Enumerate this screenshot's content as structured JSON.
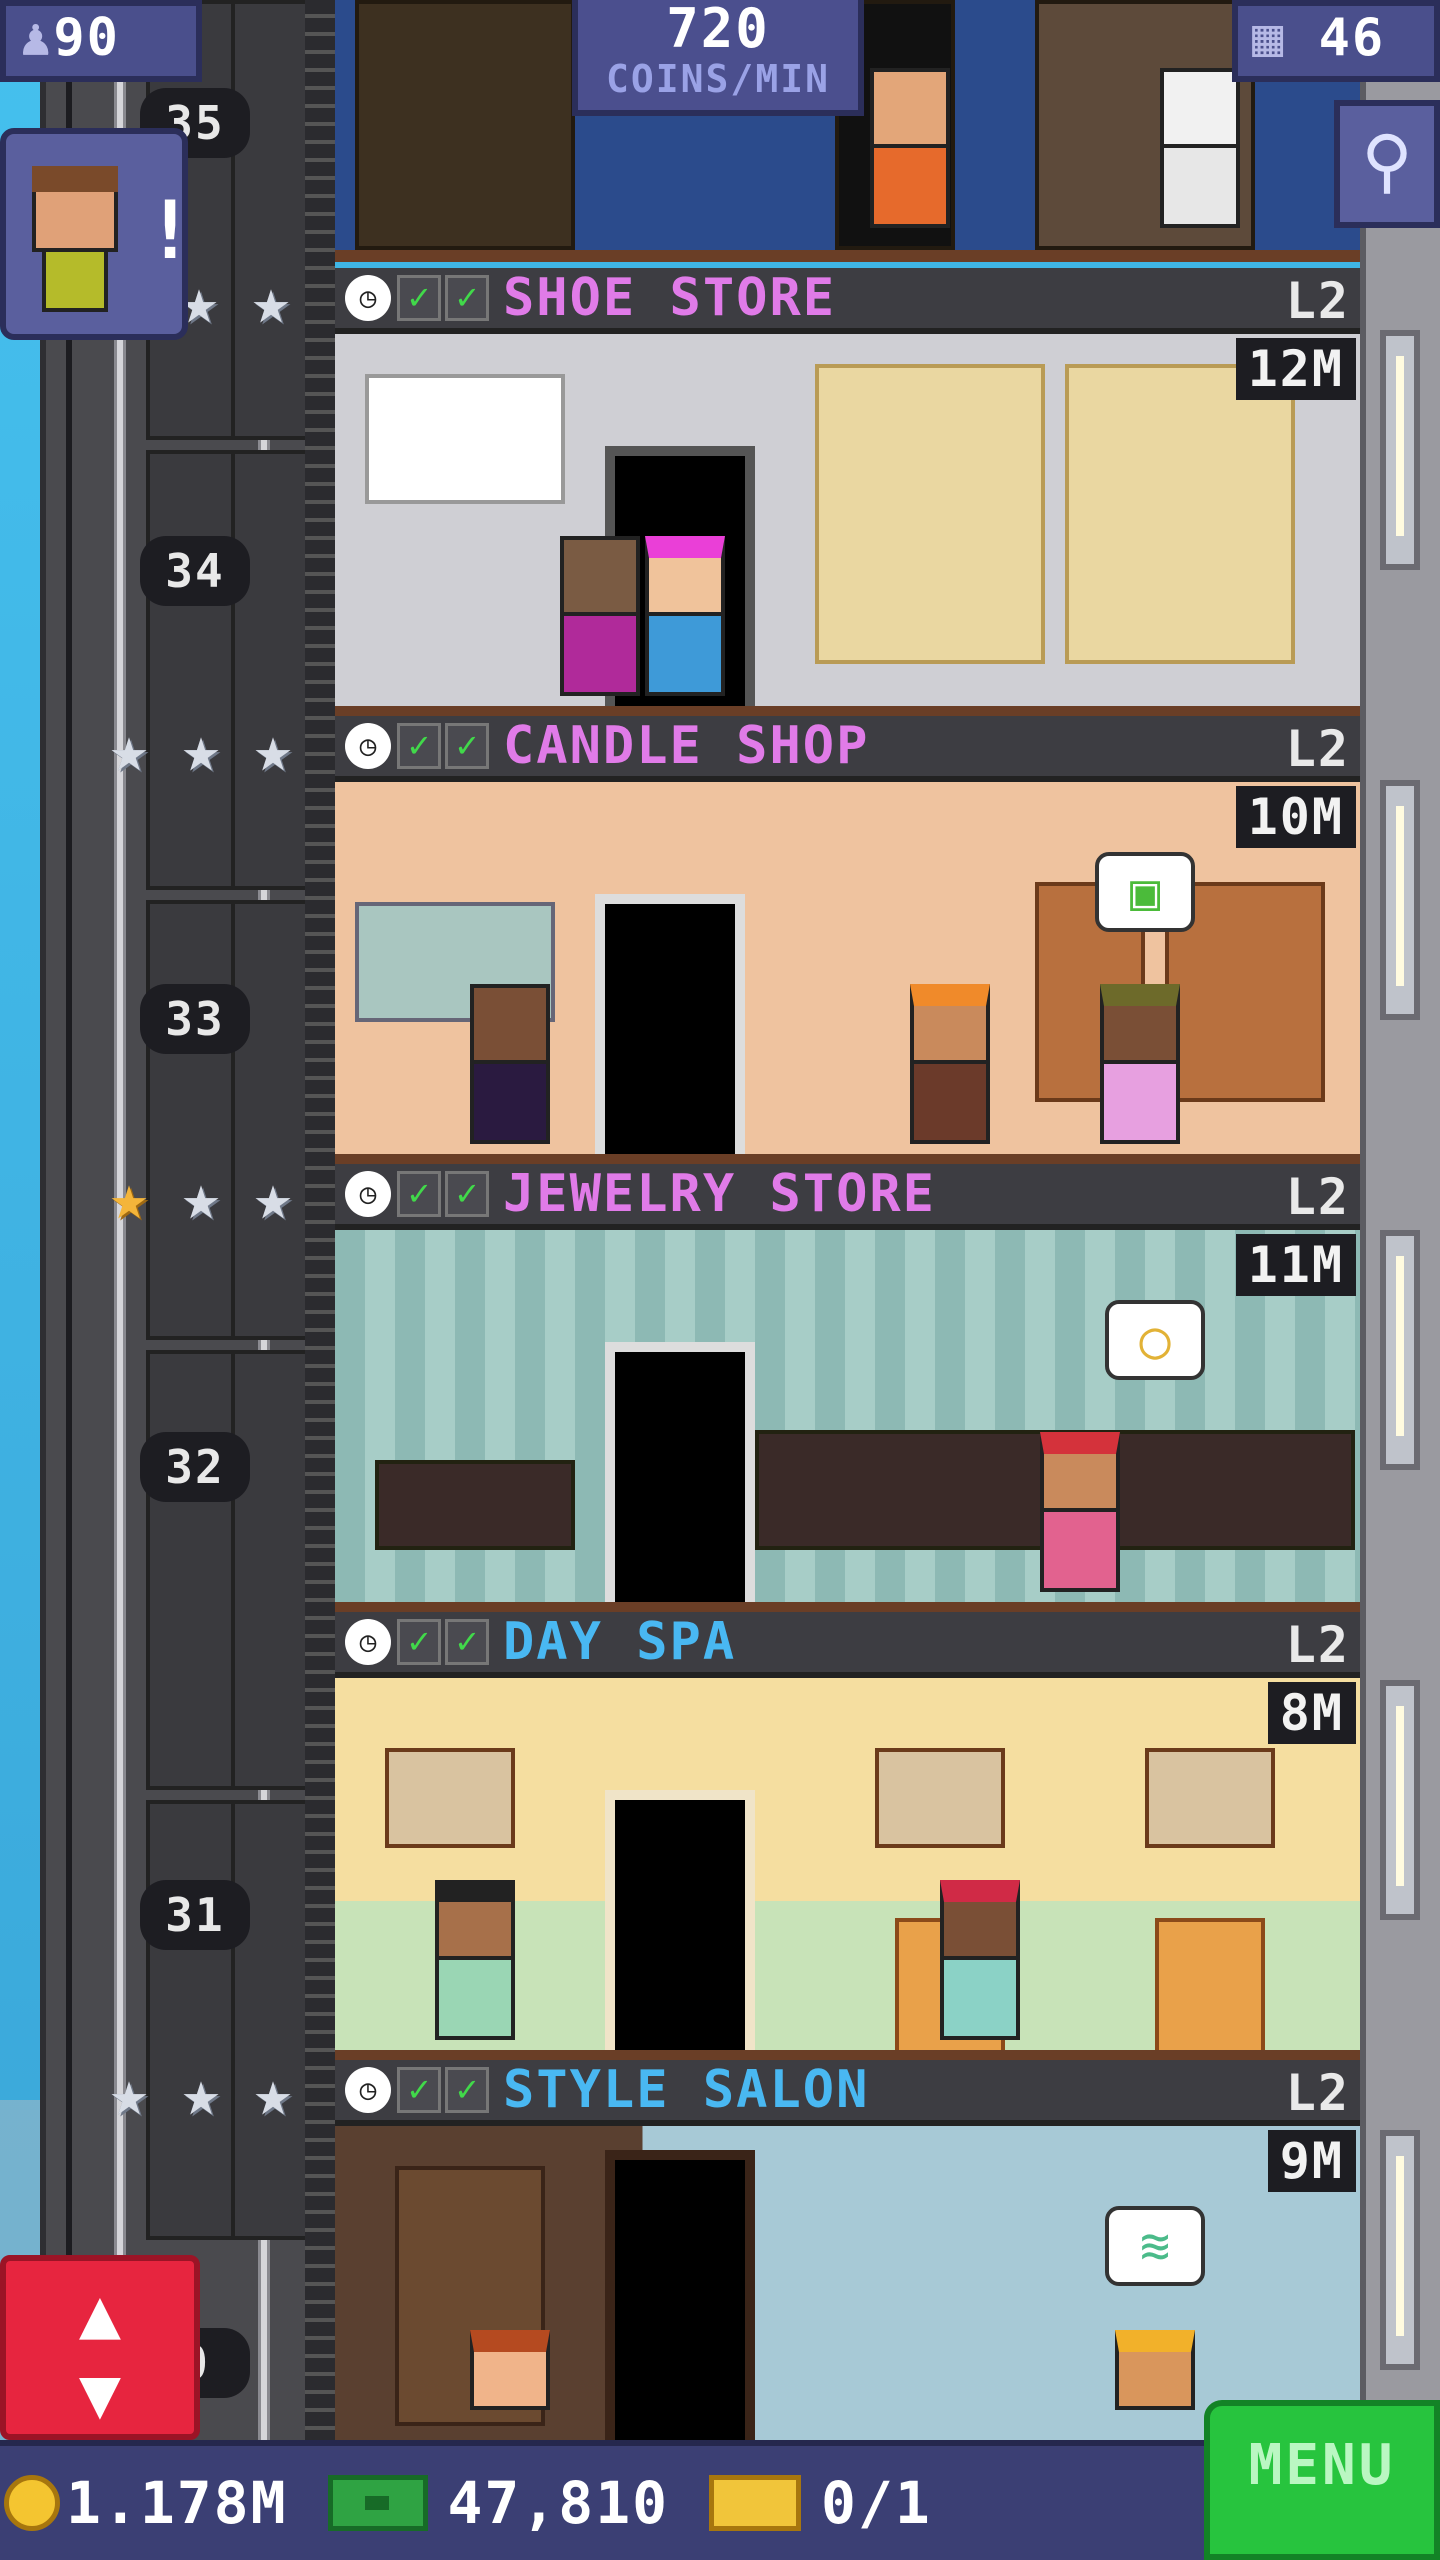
{
  "hud": {
    "population": "90",
    "population_icon": "people-icon",
    "coins_per_min_value": "720",
    "coins_per_min_label": "COINS/MIN",
    "floors_count": "46",
    "floors_icon": "building-icon"
  },
  "shaft": {
    "floor_numbers": [
      "35",
      "34",
      "33",
      "32",
      "31",
      "0"
    ],
    "star_rows": [
      {
        "stars": [
          "silver",
          "silver"
        ]
      },
      {
        "stars": [
          "silver",
          "silver",
          "silver"
        ]
      },
      {
        "stars": [
          "gold",
          "silver",
          "silver"
        ]
      },
      {
        "stars": [
          "silver",
          "silver",
          "silver"
        ]
      }
    ]
  },
  "floors": [
    {
      "name": "SHOE STORE",
      "name_color": "#e07be8",
      "level": "L2",
      "price": "12M"
    },
    {
      "name": "CANDLE SHOP",
      "name_color": "#e07be8",
      "level": "L2",
      "price": "10M"
    },
    {
      "name": "JEWELRY STORE",
      "name_color": "#e07be8",
      "level": "L2",
      "price": "11M"
    },
    {
      "name": "DAY SPA",
      "name_color": "#49b8f2",
      "level": "L2",
      "price": "8M"
    },
    {
      "name": "STYLE SALON",
      "name_color": "#49b8f2",
      "level": "L2",
      "price": "9M"
    }
  ],
  "floor_icons": {
    "clock": "clock-icon",
    "check": "checkmark-icon"
  },
  "bottom": {
    "coins": "1.178M",
    "bux": "47,810",
    "tickets": "0/1",
    "menu_label": "MENU"
  },
  "icons": {
    "search": "magnifier-icon",
    "elevator": "elevator-arrows-icon",
    "resident": "resident-alert-icon"
  }
}
